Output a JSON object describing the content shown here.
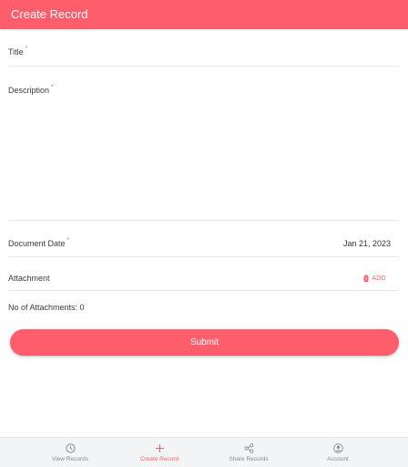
{
  "header": {
    "title": "Create Record"
  },
  "form": {
    "title_label": "Title",
    "description_label": "Description",
    "document_date_label": "Document Date",
    "document_date_value": "Jan 21, 2023",
    "attachment_label": "Attachment",
    "add_label": "ADD",
    "attachment_count": "No of Attachments: 0",
    "required_marker": "*",
    "title_value": "",
    "description_value": ""
  },
  "submit": {
    "label": "Submit"
  },
  "bottom_nav": {
    "items": [
      {
        "label": "View Records",
        "icon": "clock-icon",
        "active": false
      },
      {
        "label": "Create Record",
        "icon": "plus-icon",
        "active": true
      },
      {
        "label": "Share Records",
        "icon": "share-icon",
        "active": false
      },
      {
        "label": "Account",
        "icon": "account-icon",
        "active": false
      }
    ]
  },
  "colors": {
    "accent": "#fe5e6b",
    "nav_background": "#f3f4f6",
    "inactive": "#8a8a8a"
  }
}
